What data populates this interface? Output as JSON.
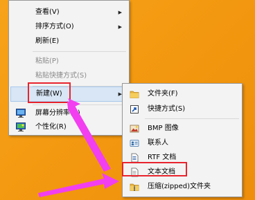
{
  "menu": {
    "items": [
      {
        "label": "查看(V)",
        "submenu": true,
        "disabled": false
      },
      {
        "label": "排序方式(O)",
        "submenu": true,
        "disabled": false
      },
      {
        "label": "刷新(E)",
        "submenu": false,
        "disabled": false
      },
      {
        "label": "粘贴(P)",
        "submenu": false,
        "disabled": true
      },
      {
        "label": "粘贴快捷方式(S)",
        "submenu": false,
        "disabled": true
      },
      {
        "label": "新建(W)",
        "submenu": true,
        "disabled": false,
        "highlighted": true
      },
      {
        "label": "屏幕分辨率(C)",
        "icon": "display-icon",
        "disabled": false
      },
      {
        "label": "个性化(R)",
        "icon": "personalize-icon",
        "disabled": false
      }
    ]
  },
  "submenu": {
    "items": [
      {
        "label": "文件夹(F)",
        "icon": "folder-icon"
      },
      {
        "label": "快捷方式(S)",
        "icon": "shortcut-icon"
      },
      {
        "label": "BMP 图像",
        "icon": "bmp-image-icon"
      },
      {
        "label": "联系人",
        "icon": "contact-icon"
      },
      {
        "label": "RTF 文档",
        "icon": "rtf-document-icon"
      },
      {
        "label": "文本文档",
        "icon": "text-document-icon",
        "highlighted": true
      },
      {
        "label": "压缩(zipped)文件夹",
        "icon": "zip-folder-icon"
      }
    ]
  },
  "colors": {
    "desktop": "#f39d17",
    "menu_bg": "#f3f3f3",
    "highlight_box": "#e8242d",
    "annotation_arrow": "#f23ff0"
  }
}
